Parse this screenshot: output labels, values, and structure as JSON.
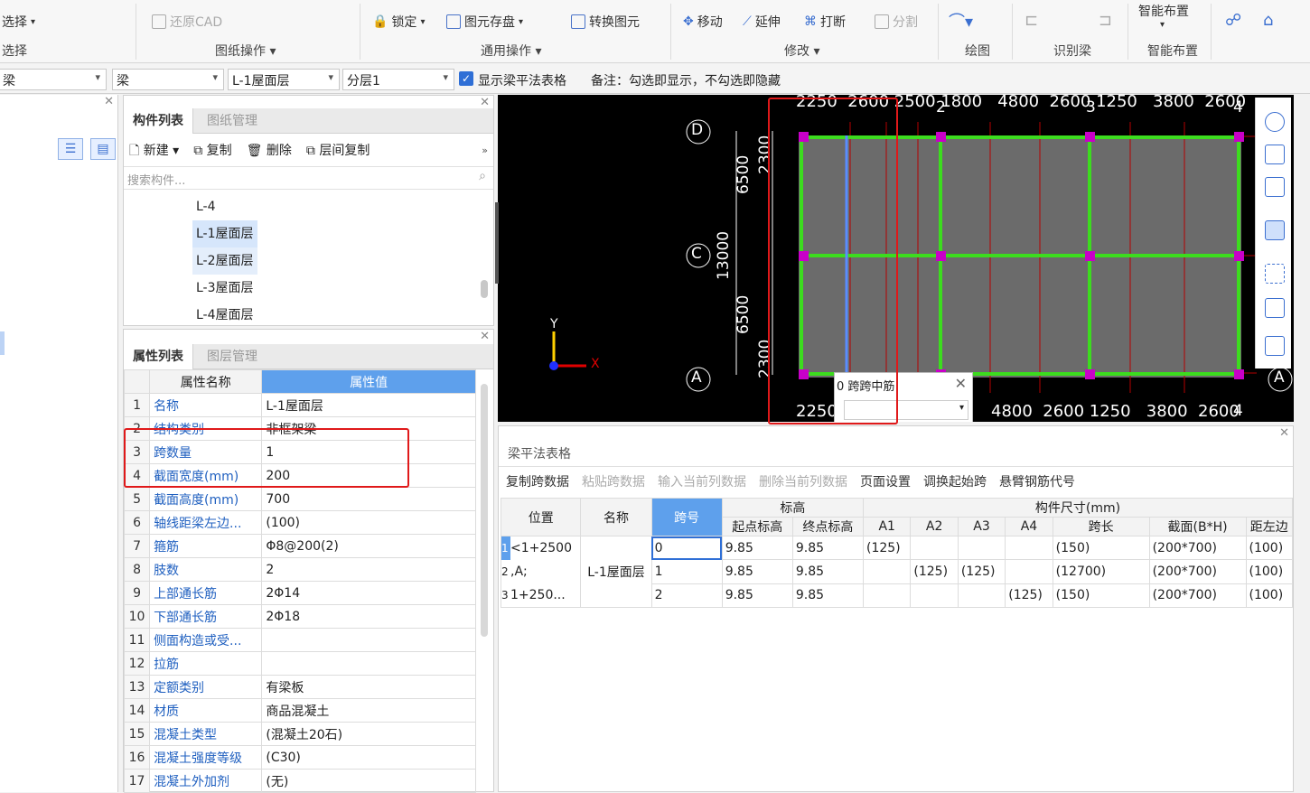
{
  "ribbon": {
    "select_label": "选择",
    "select_group": "选择",
    "restore_cad": "还原CAD",
    "drawing_ops": "图纸操作",
    "lock": "锁定",
    "save_elements": "图元存盘",
    "convert_elements": "转换图元",
    "common_ops": "通用操作",
    "move": "移动",
    "extend": "延伸",
    "break": "打断",
    "split": "分割",
    "modify": "修改",
    "draw": "绘图",
    "identify_beam": "识别梁",
    "smart_layout": "智能布置",
    "smart_layout_group": "智能布置"
  },
  "filter": {
    "c1": "梁",
    "c2": "梁",
    "c3": "L-1屋面层",
    "c4": "分层1",
    "show_table": "显示梁平法表格",
    "note": "备注：勾选即显示，不勾选即隐藏"
  },
  "components": {
    "tabs": [
      "构件列表",
      "图纸管理"
    ],
    "new": "新建",
    "copy": "复制",
    "delete": "删除",
    "floor_copy": "层间复制",
    "search_placeholder": "搜索构件...",
    "items": [
      "L-4",
      "L-1屋面层",
      "L-2屋面层",
      "L-3屋面层",
      "L-4屋面层"
    ]
  },
  "props": {
    "tabs": [
      "属性列表",
      "图层管理"
    ],
    "col_name": "属性名称",
    "col_value": "属性值",
    "rows": [
      {
        "n": "1",
        "name": "名称",
        "value": "L-1屋面层"
      },
      {
        "n": "2",
        "name": "结构类别",
        "value": "非框架梁"
      },
      {
        "n": "3",
        "name": "跨数量",
        "value": "1"
      },
      {
        "n": "4",
        "name": "截面宽度(mm)",
        "value": "200"
      },
      {
        "n": "5",
        "name": "截面高度(mm)",
        "value": "700"
      },
      {
        "n": "6",
        "name": "轴线距梁左边...",
        "value": "(100)"
      },
      {
        "n": "7",
        "name": "箍筋",
        "value": "Φ8@200(2)"
      },
      {
        "n": "8",
        "name": "肢数",
        "value": "2"
      },
      {
        "n": "9",
        "name": "上部通长筋",
        "value": "2Φ14"
      },
      {
        "n": "10",
        "name": "下部通长筋",
        "value": "2Φ18"
      },
      {
        "n": "11",
        "name": "侧面构造或受...",
        "value": ""
      },
      {
        "n": "12",
        "name": "拉筋",
        "value": ""
      },
      {
        "n": "13",
        "name": "定额类别",
        "value": "有梁板"
      },
      {
        "n": "14",
        "name": "材质",
        "value": "商品混凝土"
      },
      {
        "n": "15",
        "name": "混凝土类型",
        "value": "(混凝土20石)"
      },
      {
        "n": "16",
        "name": "混凝土强度等级",
        "value": "(C30)"
      },
      {
        "n": "17",
        "name": "混凝土外加剂",
        "value": "(无)"
      }
    ]
  },
  "canvas": {
    "axis_D": "D",
    "axis_C": "C",
    "axis_A": "A",
    "axis_A2": "A",
    "dim_6500a": "6500",
    "dim_6500b": "6500",
    "dim_13000": "13000",
    "dim_2300a": "2300",
    "dim_2300b": "2300",
    "top_dims": "2250  2600 2500 1800   4800  2600 1250   3800  2600",
    "bottom_dims": "2250",
    "bottom_dims_r": "4800  2600 1250   3800  2600",
    "grid_2": "2",
    "grid_3": "3",
    "grid_4": "4",
    "grid_4b": "4",
    "axis_y": "Y",
    "axis_x": "X",
    "popup_title": "0 跨跨中筋"
  },
  "table": {
    "title": "梁平法表格",
    "toolbar": [
      "复制跨数据",
      "粘贴跨数据",
      "输入当前列数据",
      "删除当前列数据",
      "页面设置",
      "调换起始跨",
      "悬臂钢筋代号"
    ],
    "toolbar_dim": [
      false,
      true,
      true,
      true,
      false,
      false,
      false
    ],
    "h_pos": "位置",
    "h_name": "名称",
    "h_span": "跨号",
    "h_elev": "标高",
    "h_start": "起点标高",
    "h_end": "终点标高",
    "h_size": "构件尺寸(mm)",
    "h_a1": "A1",
    "h_a2": "A2",
    "h_a3": "A3",
    "h_a4": "A4",
    "h_len": "跨长",
    "h_sec": "截面(B*H)",
    "h_left": "距左边",
    "rows": [
      {
        "idx": "1",
        "pos": "<1+2500",
        "name": "",
        "span": "0",
        "start": "9.85",
        "end": "9.85",
        "a1": "(125)",
        "a2": "",
        "a3": "",
        "a4": "",
        "len": "(150)",
        "sec": "(200*700)",
        "left": "(100)"
      },
      {
        "idx": "2",
        "pos": ",A;",
        "name": "L-1屋面层",
        "span": "1",
        "start": "9.85",
        "end": "9.85",
        "a1": "",
        "a2": "(125)",
        "a3": "(125)",
        "a4": "",
        "len": "(12700)",
        "sec": "(200*700)",
        "left": "(100)"
      },
      {
        "idx": "3",
        "pos": "1+250...",
        "name": "",
        "span": "2",
        "start": "9.85",
        "end": "9.85",
        "a1": "",
        "a2": "",
        "a3": "",
        "a4": "(125)",
        "len": "(150)",
        "sec": "(200*700)",
        "left": "(100)"
      }
    ]
  }
}
